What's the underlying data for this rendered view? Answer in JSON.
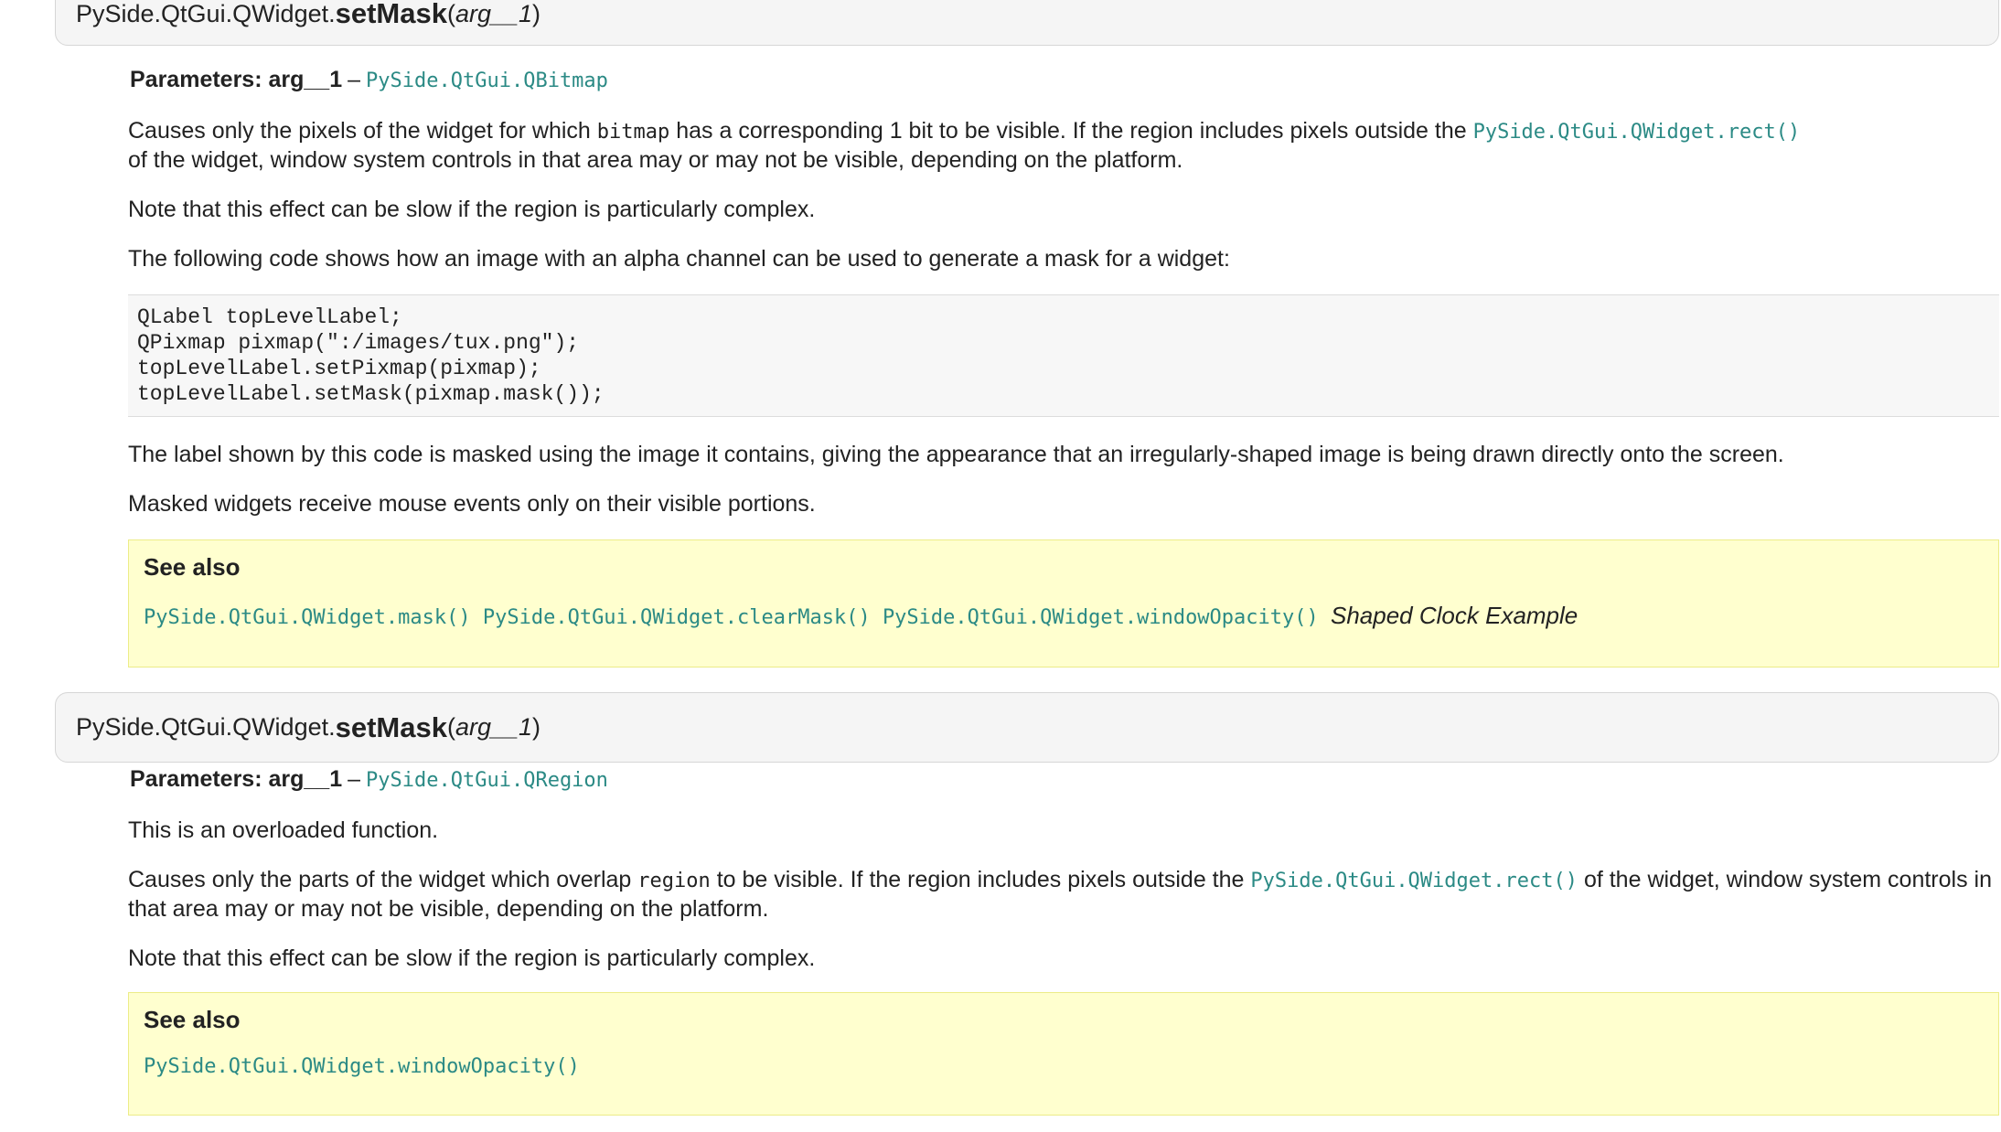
{
  "section1": {
    "signature": {
      "prefix": "PySide.QtGui.QWidget.",
      "name": "setMask",
      "open": "(",
      "arg": "arg__1",
      "close": ")"
    },
    "params": {
      "label": "Parameters:",
      "arg": "arg__1",
      "dash": "–",
      "type": "PySide.QtGui.QBitmap"
    },
    "p1": {
      "a": "Causes only the pixels of the widget for which ",
      "code": "bitmap",
      "b": " has a corresponding 1 bit to be visible. If the region includes pixels outside the ",
      "link": "PySide.QtGui.QWidget.rect()",
      "c": " of the widget, window system controls in that area may or may not be visible, depending on the platform."
    },
    "p2": "Note that this effect can be slow if the region is particularly complex.",
    "p3": "The following code shows how an image with an alpha channel can be used to generate a mask for a widget:",
    "code_lines": [
      "QLabel topLevelLabel;",
      "QPixmap pixmap(\":/images/tux.png\");",
      "topLevelLabel.setPixmap(pixmap);",
      "topLevelLabel.setMask(pixmap.mask());"
    ],
    "p4": "The label shown by this code is masked using the image it contains, giving the appearance that an irregularly-shaped image is being drawn directly onto the screen.",
    "p5": "Masked widgets receive mouse events only on their visible portions.",
    "see_also": {
      "title": "See also",
      "links": [
        "PySide.QtGui.QWidget.mask()",
        "PySide.QtGui.QWidget.clearMask()",
        "PySide.QtGui.QWidget.windowOpacity()"
      ],
      "example": "Shaped Clock Example"
    }
  },
  "section2": {
    "signature": {
      "prefix": "PySide.QtGui.QWidget.",
      "name": "setMask",
      "open": "(",
      "arg": "arg__1",
      "close": ")"
    },
    "params": {
      "label": "Parameters:",
      "arg": "arg__1",
      "dash": "–",
      "type": "PySide.QtGui.QRegion"
    },
    "p1": "This is an overloaded function.",
    "p2": {
      "a": "Causes only the parts of the widget which overlap ",
      "code": "region",
      "b": " to be visible. If the region includes pixels outside the ",
      "link": "PySide.QtGui.QWidget.rect()",
      "c": " of the widget, window system controls in that area may or may not be visible, depending on the platform."
    },
    "p3": "Note that this effect can be slow if the region is particularly complex.",
    "see_also": {
      "title": "See also",
      "links": [
        "PySide.QtGui.QWidget.windowOpacity()"
      ]
    }
  },
  "colors": {
    "link": "#2b8a85",
    "signature_bg": "#f5f5f5",
    "see_also_bg": "#ffffcf",
    "see_also_border": "#ecec88",
    "code_bg": "#f7f7f7"
  }
}
